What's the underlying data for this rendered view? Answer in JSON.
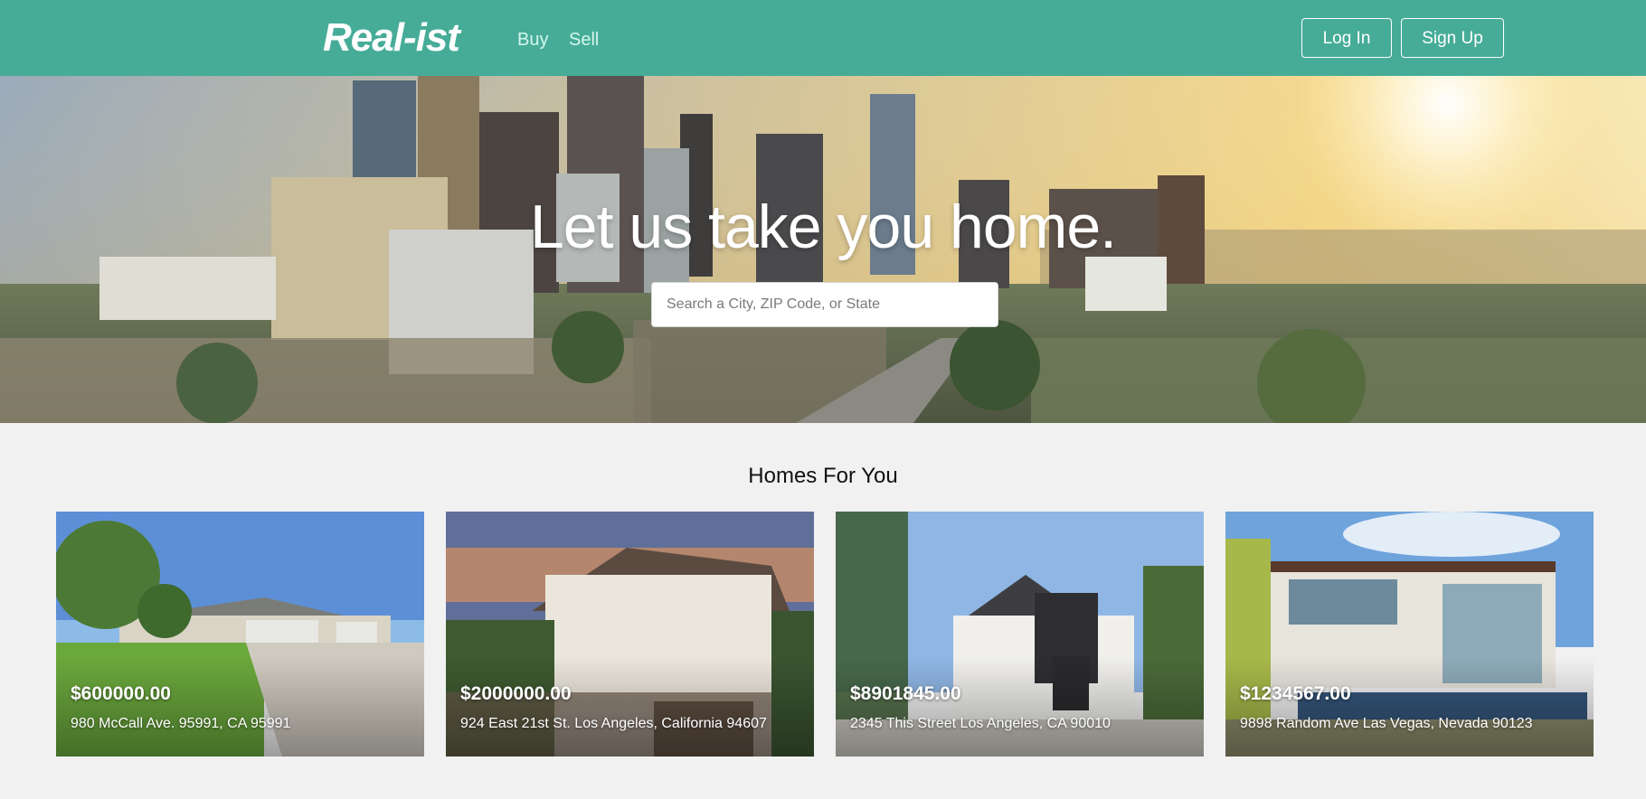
{
  "header": {
    "logo": "Real-ist",
    "nav": [
      {
        "label": "Buy"
      },
      {
        "label": "Sell"
      }
    ],
    "login_label": "Log In",
    "signup_label": "Sign Up"
  },
  "hero": {
    "title": "Let us take you home.",
    "search_placeholder": "Search a City, ZIP Code, or State",
    "search_value": ""
  },
  "section": {
    "title": "Homes For You"
  },
  "listings": [
    {
      "price": "$600000.00",
      "address": "980 McCall Ave. 95991, CA 95991"
    },
    {
      "price": "$2000000.00",
      "address": "924 East 21st St. Los Angeles, California 94607"
    },
    {
      "price": "$8901845.00",
      "address": "2345 This Street Los Angeles, CA 90010"
    },
    {
      "price": "$1234567.00",
      "address": "9898 Random Ave Las Vegas, Nevada 90123"
    }
  ],
  "colors": {
    "brand": "#46ac98",
    "nav_link": "#d4f6ec",
    "page_bg": "#f1f1f1"
  }
}
